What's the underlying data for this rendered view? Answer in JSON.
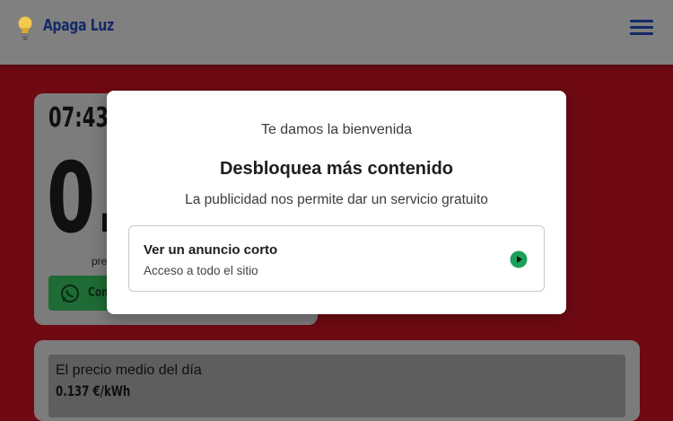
{
  "header": {
    "brand": "Apaga Luz",
    "logo_icon": "lightbulb-icon",
    "menu_icon": "hamburger-menu-icon"
  },
  "card_now": {
    "time": "07:43",
    "price_visible": "0.",
    "price_label_visible": "pre",
    "share_button_visible": "Com",
    "share_icon": "whatsapp-icon"
  },
  "card_avg": {
    "label": "El precio medio del día",
    "value": "0.137 €/kWh"
  },
  "modal": {
    "welcome": "Te damos la bienvenida",
    "title": "Desbloquea más contenido",
    "subtitle": "La publicidad nos permite dar un servicio gratuito",
    "option": {
      "title": "Ver un anuncio corto",
      "subtitle": "Acceso a todo el sitio",
      "icon": "play-icon"
    }
  },
  "colors": {
    "page_background": "#6f0a13",
    "header_background": "#808080",
    "brand_text": "#142a66",
    "whatsapp_green": "#1f6b35",
    "play_green": "#1aa05a"
  }
}
